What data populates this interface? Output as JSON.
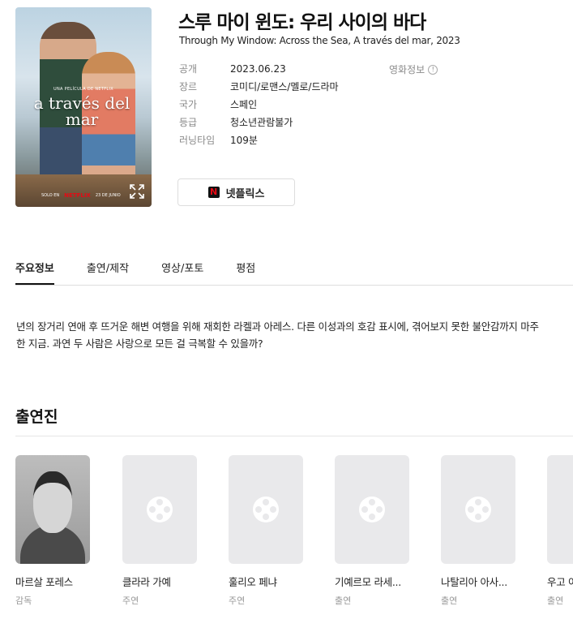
{
  "poster": {
    "title_art": "a través del mar",
    "tagline": "UNA PELÍCULA DE NETFLIX",
    "bottom_left": "SOLO EN",
    "bottom_brand": "NETFLIX",
    "bottom_date": "23 DE JUNIO",
    "expand_icon": "expand-icon"
  },
  "movie": {
    "title": "스루 마이 윈도: 우리 사이의 바다",
    "subtitle": "Through My Window: Across the Sea, A través del mar, 2023",
    "info": [
      {
        "key": "공개",
        "value": "2023.06.23"
      },
      {
        "key": "장르",
        "value": "코미디/로맨스/멜로/드라마"
      },
      {
        "key": "국가",
        "value": "스페인"
      },
      {
        "key": "등급",
        "value": "청소년관람불가"
      },
      {
        "key": "러닝타임",
        "value": "109분"
      }
    ],
    "movie_info_link": "영화정보",
    "info_icon_glyph": "!"
  },
  "watch": {
    "logo_glyph": "N",
    "label": "넷플릭스",
    "brand_color": "#e50914"
  },
  "tabs": [
    {
      "label": "주요정보",
      "active": true
    },
    {
      "label": "출연/제작",
      "active": false
    },
    {
      "label": "영상/포토",
      "active": false
    },
    {
      "label": "평점",
      "active": false
    }
  ],
  "synopsis": "년의 장거리 연애 후 뜨거운 해변 여행을 위해 재회한 라켈과 아레스. 다른 이성과의 호감 표시에, 겪어보지 못한 불안감까지 마주한 지금. 과연 두 사람은 사랑으로 모든 걸 극복할 수 있을까?",
  "cast": {
    "heading": "출연진",
    "members": [
      {
        "name": "마르살 포레스",
        "role": "감독",
        "photo": "portrait"
      },
      {
        "name": "클라라 가예",
        "role": "주연",
        "photo": "film-reel-icon"
      },
      {
        "name": "훌리오 페냐",
        "role": "주연",
        "photo": "film-reel-icon"
      },
      {
        "name": "기예르모 라세...",
        "role": "출연",
        "photo": "film-reel-icon"
      },
      {
        "name": "나탈리아 아사...",
        "role": "출연",
        "photo": "film-reel-icon"
      },
      {
        "name": "우고 아",
        "role": "출연",
        "photo": "film-reel-icon"
      }
    ]
  }
}
